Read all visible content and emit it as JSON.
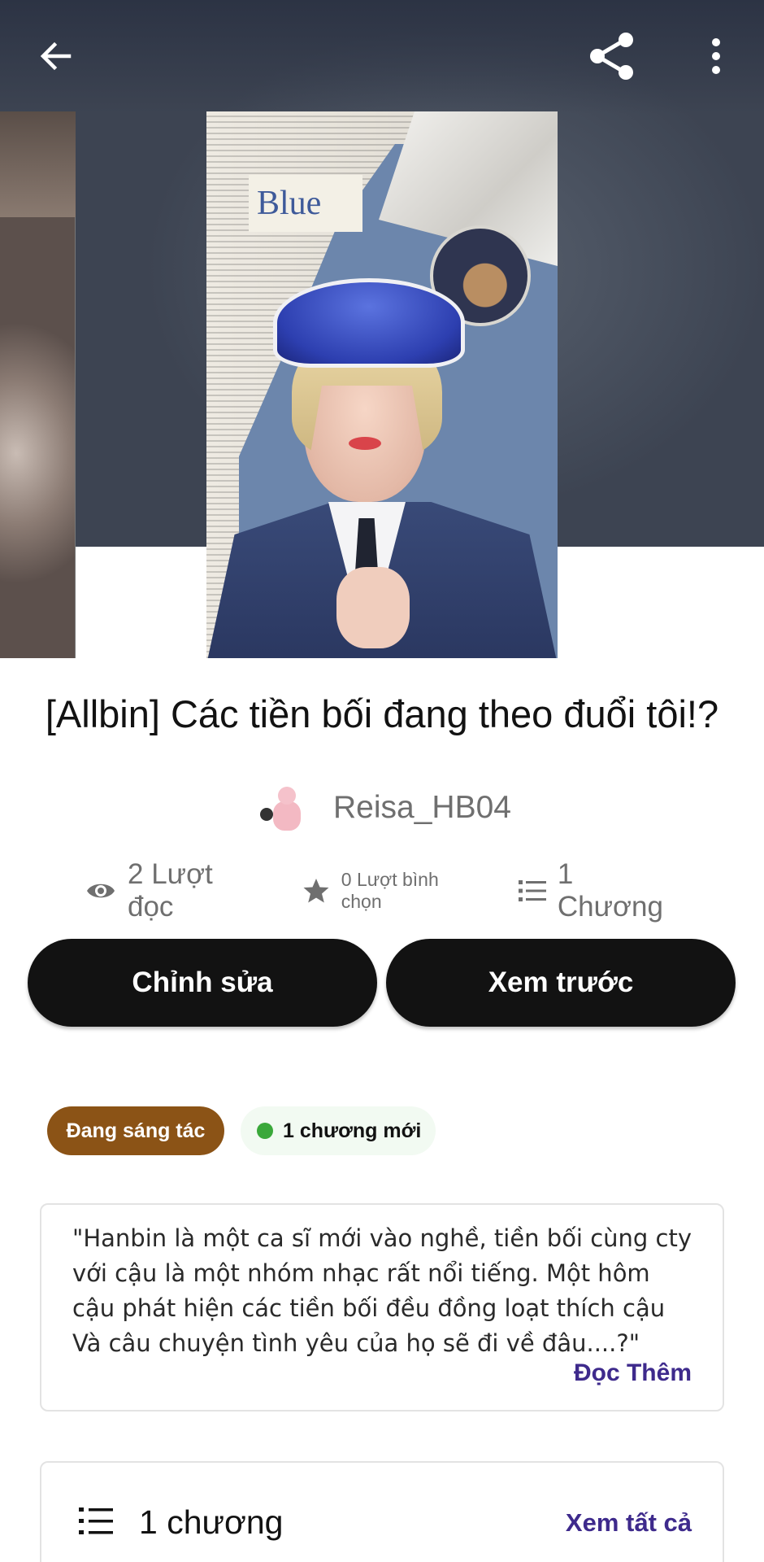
{
  "header": {
    "back_icon": "arrow-left-icon",
    "share_icon": "share-icon",
    "more_icon": "more-vertical-icon"
  },
  "story": {
    "title": "[Allbin] Các tiền bối đang theo đuổi tôi!?",
    "cover_text": "Blue",
    "author": "Reisa_HB04"
  },
  "stats": {
    "reads": "2 Lượt đọc",
    "votes": "0 Lượt bình chọn",
    "chapters": "1 Chương"
  },
  "actions": {
    "edit_label": "Chỉnh sửa",
    "preview_label": "Xem trước"
  },
  "tags": {
    "status": "Đang sáng tác",
    "new_chapters": "1 chương mới"
  },
  "description": {
    "text": "\"Hanbin là một ca sĩ mới vào nghề, tiền bối cùng cty với cậu là một nhóm nhạc rất nổi tiếng. Một hôm cậu phát hiện các tiền bối đều đồng loạt thích cậu Và câu chuyện tình yêu của họ sẽ đi về đâu....?\"",
    "read_more": "Đọc Thêm"
  },
  "chapters_section": {
    "label": "1 chương",
    "see_all": "Xem tất cả"
  },
  "colors": {
    "status_tag": "#8b5316",
    "new_dot": "#3aa83a",
    "link": "#3e2a8c",
    "button_bg": "#121212"
  }
}
